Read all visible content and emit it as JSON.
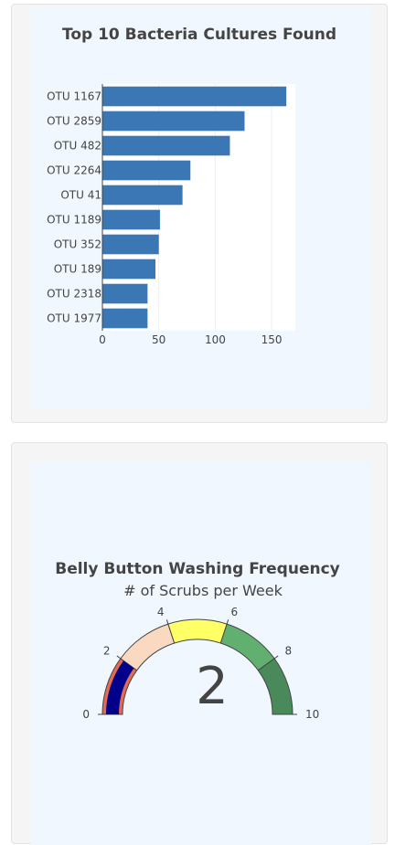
{
  "chart_data": [
    {
      "type": "bar",
      "orientation": "horizontal",
      "title": "Top 10 Bacteria Cultures Found",
      "categories": [
        "OTU 1167",
        "OTU 2859",
        "OTU 482",
        "OTU 2264",
        "OTU 41",
        "OTU 1189",
        "OTU 352",
        "OTU 189",
        "OTU 2318",
        "OTU 1977"
      ],
      "values": [
        163,
        126,
        113,
        78,
        71,
        51,
        50,
        47,
        40,
        40
      ],
      "xticks": [
        0,
        50,
        100,
        150
      ],
      "xlim": [
        0,
        171
      ],
      "grid": true,
      "bar_color": "#3a77b4"
    },
    {
      "type": "gauge",
      "title": "Belly Button Washing Frequency",
      "subtitle": "# of Scrubs per Week",
      "value": 2,
      "value_label": "2",
      "range": [
        0,
        10
      ],
      "ticks": [
        0,
        2,
        4,
        6,
        8,
        10
      ],
      "bands": [
        {
          "from": 0,
          "to": 2,
          "color": "#e56a53"
        },
        {
          "from": 2,
          "to": 4,
          "color": "#fad9c0"
        },
        {
          "from": 4,
          "to": 6,
          "color": "#ffff66"
        },
        {
          "from": 6,
          "to": 8,
          "color": "#62b070"
        },
        {
          "from": 8,
          "to": 10,
          "color": "#4a8a5a"
        }
      ],
      "bar_color": "#00008b"
    }
  ]
}
